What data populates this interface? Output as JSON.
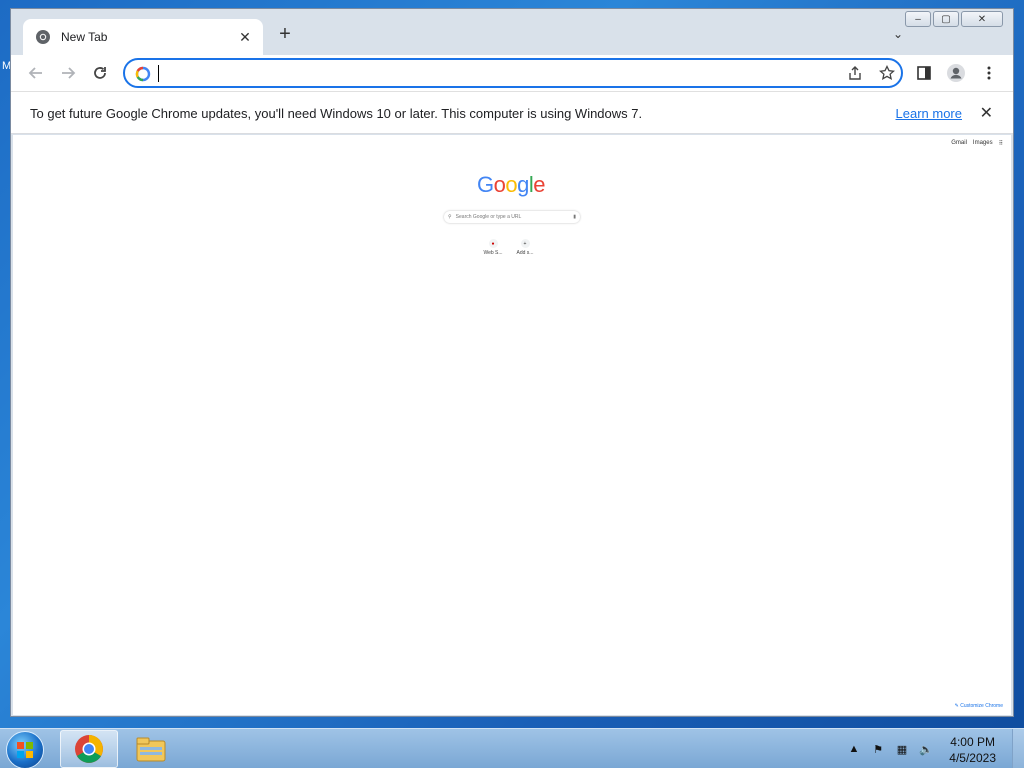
{
  "desktop": {
    "edge_text": "M"
  },
  "window": {
    "controls": {
      "minimize": "–",
      "maximize": "▢",
      "close": "✕"
    }
  },
  "tab": {
    "title": "New Tab",
    "close": "✕"
  },
  "toolbar": {
    "new_tab": "+",
    "tab_search": "⌄",
    "omnibox_value": ""
  },
  "infobar": {
    "message": "To get future Google Chrome updates, you'll need Windows 10 or later. This computer is using Windows 7.",
    "learn_more": "Learn more",
    "close": "✕"
  },
  "ntp": {
    "top_links": [
      "Gmail",
      "Images"
    ],
    "logo_letters": [
      "G",
      "o",
      "o",
      "g",
      "l",
      "e"
    ],
    "logo_colors": [
      "#4285f4",
      "#ea4335",
      "#fbbc05",
      "#4285f4",
      "#34a853",
      "#ea4335"
    ],
    "search_placeholder": "Search Google or type a URL",
    "shortcuts": [
      {
        "label": "Web S..."
      },
      {
        "label": "Add s..."
      }
    ],
    "customize": "Customize Chrome"
  },
  "taskbar": {
    "clock_time": "4:00 PM",
    "clock_date": "4/5/2023"
  }
}
